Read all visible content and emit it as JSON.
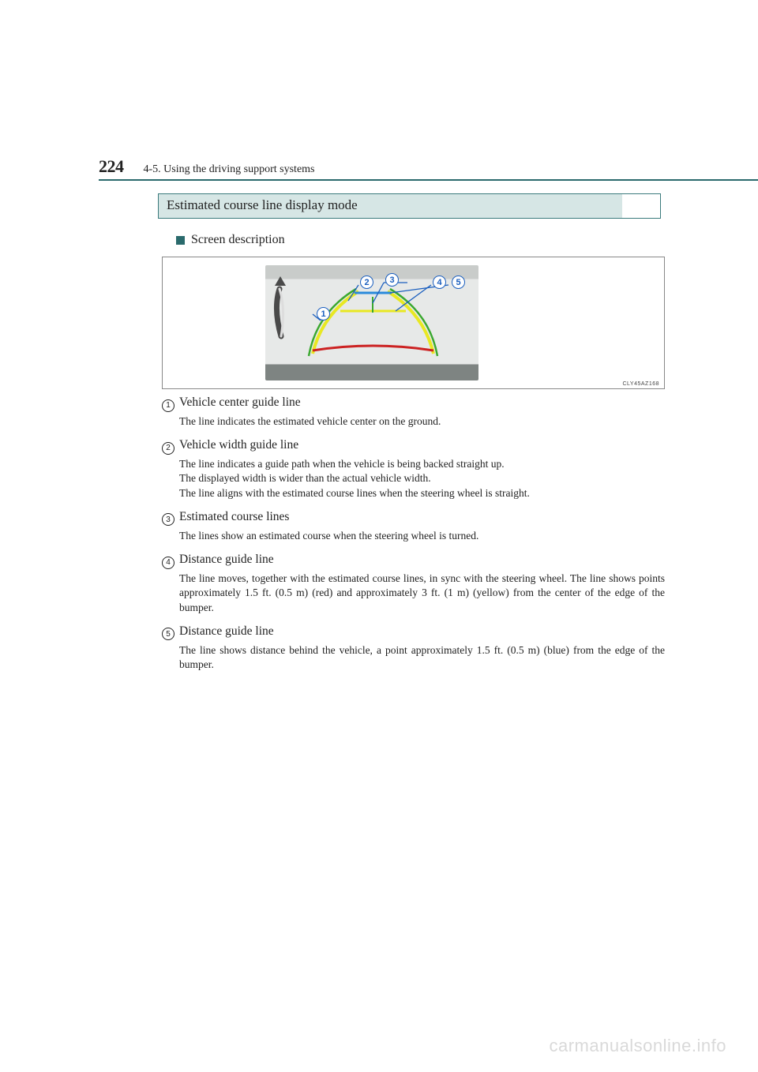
{
  "header": {
    "page_number": "224",
    "section": "4-5. Using the driving support systems"
  },
  "mode_title": "Estimated course line display mode",
  "subsection": "Screen description",
  "figure": {
    "code": "CLY45AZ168",
    "callouts": [
      "1",
      "2",
      "3",
      "4",
      "5"
    ]
  },
  "items": [
    {
      "num": "1",
      "title": "Vehicle center guide line",
      "desc": "The line indicates the estimated vehicle center on the ground."
    },
    {
      "num": "2",
      "title": "Vehicle width guide line",
      "desc": "The line indicates a guide path when the vehicle is being backed straight up.\nThe displayed width is wider than the actual vehicle width.\nThe line aligns with the estimated course lines when the steering wheel is straight."
    },
    {
      "num": "3",
      "title": "Estimated course lines",
      "desc": "The lines show an estimated course when the steering wheel is turned."
    },
    {
      "num": "4",
      "title": "Distance guide line",
      "desc": "The line moves, together with the estimated course lines, in sync with the steering wheel. The line shows points approximately 1.5 ft. (0.5 m) (red) and approximately 3 ft. (1 m) (yellow) from the center of the edge of the bumper."
    },
    {
      "num": "5",
      "title": "Distance guide line",
      "desc": "The line shows distance behind the vehicle, a point approximately 1.5 ft. (0.5 m) (blue) from the edge of the bumper."
    }
  ],
  "watermark": "carmanualsonline.info"
}
